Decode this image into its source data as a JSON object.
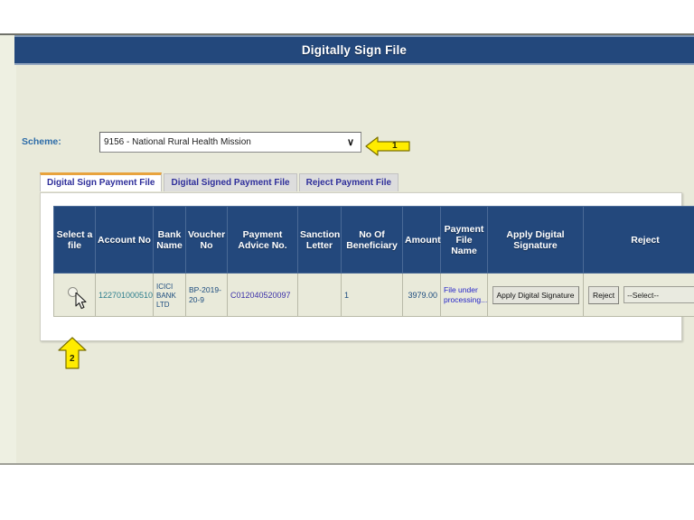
{
  "page": {
    "banner_title": "Digitally Sign File",
    "background_color": "#e9eada",
    "banner_color": "#23487c",
    "accent_color": "#e8a33d",
    "callout_color": "#ffec00"
  },
  "scheme": {
    "label": "Scheme:",
    "selected": "9156 - National Rural Health Mission",
    "caret": "∨"
  },
  "callouts": [
    {
      "number": "1",
      "direction": "left",
      "target": "scheme-dropdown"
    },
    {
      "number": "2",
      "direction": "up",
      "target": "select-a-file-radio"
    }
  ],
  "tabs": [
    {
      "label": "Digital Sign Payment File",
      "active": true
    },
    {
      "label": "Digital Signed Payment File",
      "active": false
    },
    {
      "label": "Reject Payment File",
      "active": false
    }
  ],
  "table": {
    "headers": [
      "Select a file",
      "Account No",
      "Bank Name",
      "Voucher No",
      "Payment Advice No.",
      "Sanction Letter",
      "No Of Beneficiary",
      "Amount",
      "Payment File Name",
      "Apply Digital Signature",
      "Reject"
    ],
    "rows": [
      {
        "select_a_file": "",
        "account_no": "122701000510",
        "bank_name": "ICICI BANK LTD",
        "voucher_no": "BP-2019-20-9",
        "payment_advice_no": "C012040520097",
        "sanction_letter": "",
        "no_of_beneficiary": "1",
        "amount": "3979.00",
        "payment_file_name": "File under processing...",
        "apply_button_label": "Apply Digital Signature",
        "reject_button_label": "Reject",
        "reject_select_value": "--Select--",
        "reject_select_caret": "∨"
      }
    ]
  }
}
